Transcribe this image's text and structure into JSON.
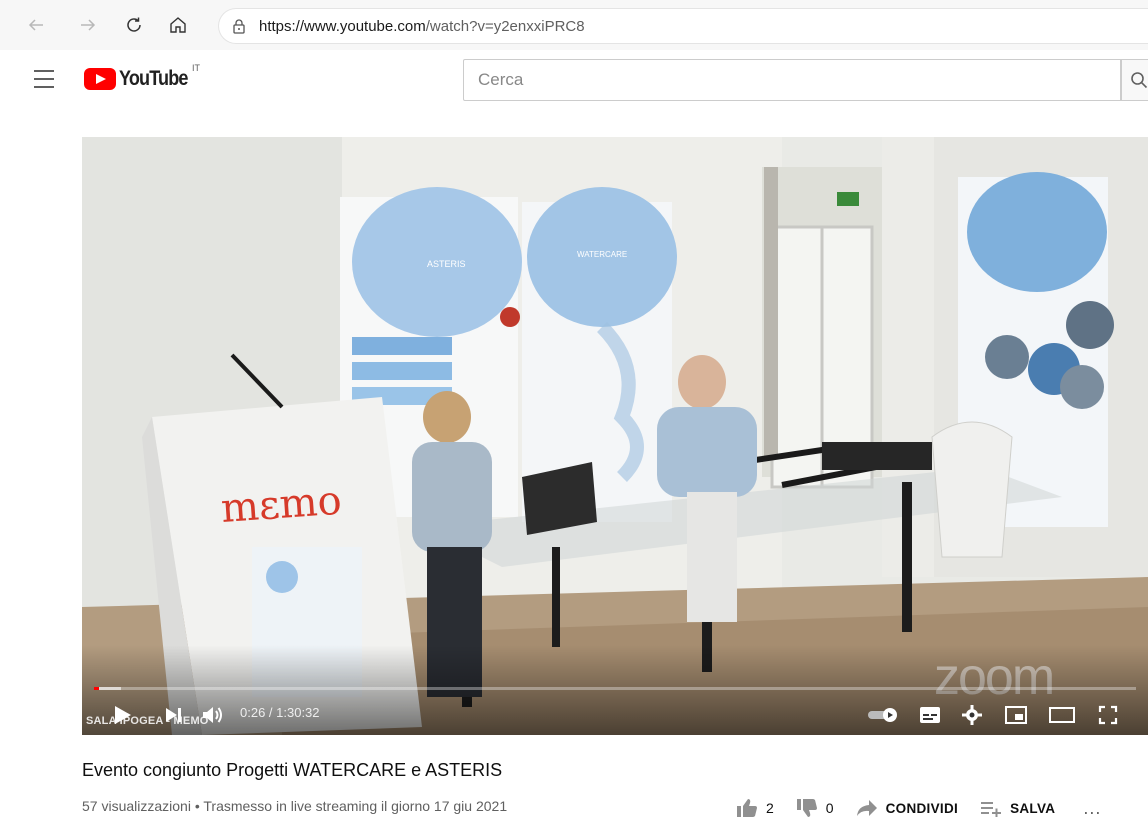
{
  "browser": {
    "url_domain": "https://www.youtube.com",
    "url_path": "/watch?v=y2enxxiPRC8"
  },
  "header": {
    "logo_text": "YouTube",
    "country_code": "IT",
    "search_placeholder": "Cerca",
    "search_value": ""
  },
  "player": {
    "current_time": "0:26",
    "separator": "/",
    "duration": "1:30:32",
    "time_label": "0:26 / 1:30:32",
    "played_fraction": 0.005,
    "loaded_fraction": 0.026,
    "overlay_label": "SALA IPOGEA - MEMO",
    "watermark": "zoom",
    "scene_sign": "mεmo",
    "banner_left": "ASTERIS",
    "banner_right": "WATERCARE"
  },
  "video": {
    "title": "Evento congiunto Progetti WATERCARE e ASTERIS",
    "views": "57 visualizzazioni",
    "bullet": "•",
    "streamed": "Trasmesso in live streaming il giorno 17 giu 2021",
    "meta_line": "57 visualizzazioni • Trasmesso in live streaming il giorno 17 giu 2021"
  },
  "actions": {
    "likes": "2",
    "dislikes": "0",
    "share_label": "CONDIVIDI",
    "save_label": "SALVA",
    "more": "..."
  },
  "colors": {
    "youtube_red": "#ff0000",
    "meta_gray": "#606060",
    "text_dark": "#0f0f0f"
  },
  "icons": [
    "back-icon",
    "forward-icon",
    "refresh-icon",
    "home-icon",
    "lock-icon",
    "hamburger-icon",
    "search-icon",
    "play-icon",
    "next-icon",
    "volume-icon",
    "autoplay-toggle-icon",
    "subtitles-icon",
    "settings-icon",
    "miniplayer-icon",
    "theater-icon",
    "fullscreen-icon",
    "like-icon",
    "dislike-icon",
    "share-icon",
    "save-playlist-icon",
    "more-icon"
  ]
}
